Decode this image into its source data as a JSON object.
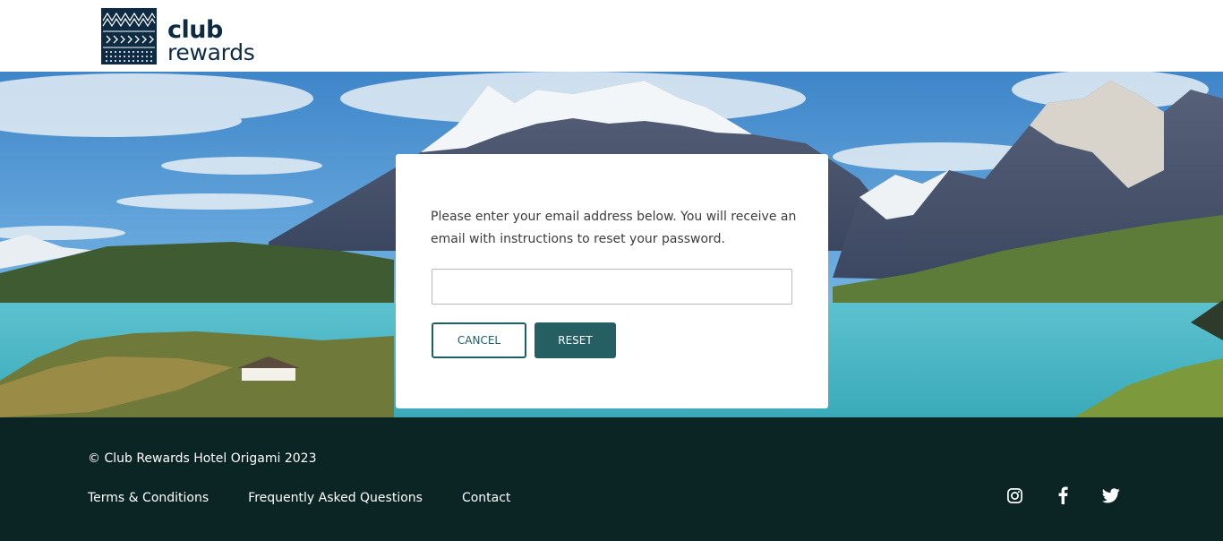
{
  "header": {
    "logo_line1": "club",
    "logo_line2": "rewards"
  },
  "reset_form": {
    "instructions": "Please enter your email address below. You will receive an email with instructions to reset your password.",
    "email_value": "",
    "email_placeholder": "",
    "cancel_label": "CANCEL",
    "reset_label": "RESET"
  },
  "footer": {
    "copyright": "© Club Rewards Hotel Origami 2023",
    "links": [
      {
        "label": "Terms & Conditions"
      },
      {
        "label": "Frequently Asked Questions"
      },
      {
        "label": "Contact"
      }
    ],
    "social": [
      {
        "icon": "instagram-icon"
      },
      {
        "icon": "facebook-icon"
      },
      {
        "icon": "twitter-icon"
      }
    ]
  },
  "colors": {
    "brand_navy": "#0e2b44",
    "primary_teal": "#255f64",
    "footer_bg": "#0b2424"
  }
}
